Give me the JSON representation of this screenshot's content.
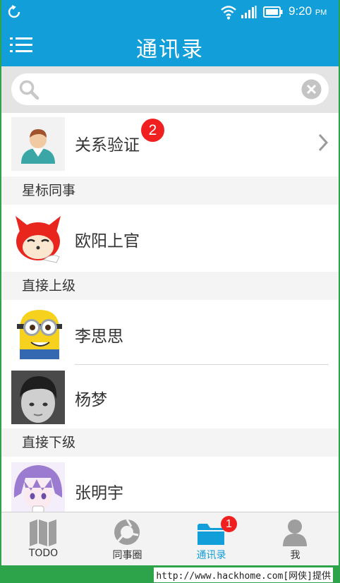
{
  "status_bar": {
    "time": "9:20",
    "ampm": "PM",
    "icons": [
      "sync-icon",
      "wifi-icon",
      "signal-icon",
      "battery-icon"
    ]
  },
  "header": {
    "title": "通讯录",
    "menu_icon": "list-menu-icon"
  },
  "search": {
    "placeholder": "",
    "value": ""
  },
  "verify": {
    "label": "关系验证",
    "badge": "2"
  },
  "sections": [
    {
      "title": "星标同事",
      "contacts": [
        {
          "name": "欧阳上官"
        }
      ]
    },
    {
      "title": "直接上级",
      "contacts": [
        {
          "name": "李思思"
        },
        {
          "name": "杨梦"
        }
      ]
    },
    {
      "title": "直接下级",
      "contacts": [
        {
          "name": "张明宇"
        }
      ]
    }
  ],
  "tabs": [
    {
      "label": "TODO",
      "icon": "map-icon"
    },
    {
      "label": "同事圈",
      "icon": "moments-icon"
    },
    {
      "label": "通讯录",
      "icon": "folder-icon",
      "badge": "1",
      "active": true
    },
    {
      "label": "我",
      "icon": "person-icon"
    }
  ],
  "footer": {
    "text": "http://www.hackhome.com[网侠]提供"
  },
  "colors": {
    "primary": "#129fd9",
    "badge": "#f02020",
    "watermark_bg": "#2ea44a"
  }
}
